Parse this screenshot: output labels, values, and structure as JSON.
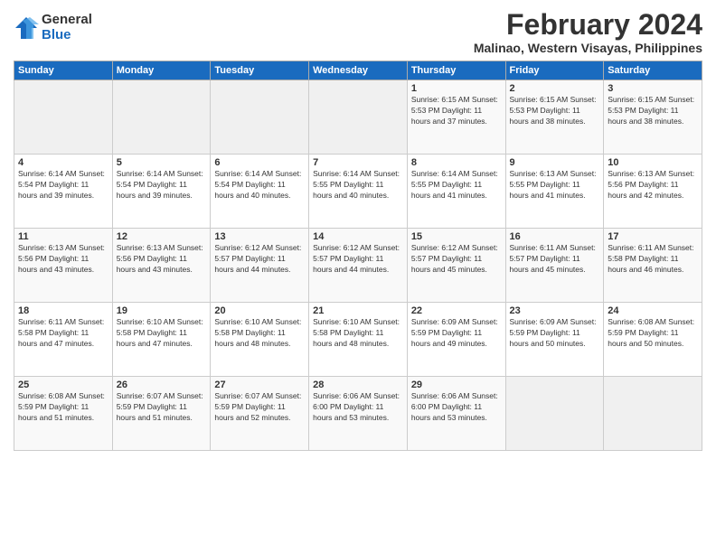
{
  "logo": {
    "general": "General",
    "blue": "Blue"
  },
  "title": "February 2024",
  "subtitle": "Malinao, Western Visayas, Philippines",
  "days_header": [
    "Sunday",
    "Monday",
    "Tuesday",
    "Wednesday",
    "Thursday",
    "Friday",
    "Saturday"
  ],
  "weeks": [
    [
      {
        "day": "",
        "content": ""
      },
      {
        "day": "",
        "content": ""
      },
      {
        "day": "",
        "content": ""
      },
      {
        "day": "",
        "content": ""
      },
      {
        "day": "1",
        "content": "Sunrise: 6:15 AM\nSunset: 5:53 PM\nDaylight: 11 hours\nand 37 minutes."
      },
      {
        "day": "2",
        "content": "Sunrise: 6:15 AM\nSunset: 5:53 PM\nDaylight: 11 hours\nand 38 minutes."
      },
      {
        "day": "3",
        "content": "Sunrise: 6:15 AM\nSunset: 5:53 PM\nDaylight: 11 hours\nand 38 minutes."
      }
    ],
    [
      {
        "day": "4",
        "content": "Sunrise: 6:14 AM\nSunset: 5:54 PM\nDaylight: 11 hours\nand 39 minutes."
      },
      {
        "day": "5",
        "content": "Sunrise: 6:14 AM\nSunset: 5:54 PM\nDaylight: 11 hours\nand 39 minutes."
      },
      {
        "day": "6",
        "content": "Sunrise: 6:14 AM\nSunset: 5:54 PM\nDaylight: 11 hours\nand 40 minutes."
      },
      {
        "day": "7",
        "content": "Sunrise: 6:14 AM\nSunset: 5:55 PM\nDaylight: 11 hours\nand 40 minutes."
      },
      {
        "day": "8",
        "content": "Sunrise: 6:14 AM\nSunset: 5:55 PM\nDaylight: 11 hours\nand 41 minutes."
      },
      {
        "day": "9",
        "content": "Sunrise: 6:13 AM\nSunset: 5:55 PM\nDaylight: 11 hours\nand 41 minutes."
      },
      {
        "day": "10",
        "content": "Sunrise: 6:13 AM\nSunset: 5:56 PM\nDaylight: 11 hours\nand 42 minutes."
      }
    ],
    [
      {
        "day": "11",
        "content": "Sunrise: 6:13 AM\nSunset: 5:56 PM\nDaylight: 11 hours\nand 43 minutes."
      },
      {
        "day": "12",
        "content": "Sunrise: 6:13 AM\nSunset: 5:56 PM\nDaylight: 11 hours\nand 43 minutes."
      },
      {
        "day": "13",
        "content": "Sunrise: 6:12 AM\nSunset: 5:57 PM\nDaylight: 11 hours\nand 44 minutes."
      },
      {
        "day": "14",
        "content": "Sunrise: 6:12 AM\nSunset: 5:57 PM\nDaylight: 11 hours\nand 44 minutes."
      },
      {
        "day": "15",
        "content": "Sunrise: 6:12 AM\nSunset: 5:57 PM\nDaylight: 11 hours\nand 45 minutes."
      },
      {
        "day": "16",
        "content": "Sunrise: 6:11 AM\nSunset: 5:57 PM\nDaylight: 11 hours\nand 45 minutes."
      },
      {
        "day": "17",
        "content": "Sunrise: 6:11 AM\nSunset: 5:58 PM\nDaylight: 11 hours\nand 46 minutes."
      }
    ],
    [
      {
        "day": "18",
        "content": "Sunrise: 6:11 AM\nSunset: 5:58 PM\nDaylight: 11 hours\nand 47 minutes."
      },
      {
        "day": "19",
        "content": "Sunrise: 6:10 AM\nSunset: 5:58 PM\nDaylight: 11 hours\nand 47 minutes."
      },
      {
        "day": "20",
        "content": "Sunrise: 6:10 AM\nSunset: 5:58 PM\nDaylight: 11 hours\nand 48 minutes."
      },
      {
        "day": "21",
        "content": "Sunrise: 6:10 AM\nSunset: 5:58 PM\nDaylight: 11 hours\nand 48 minutes."
      },
      {
        "day": "22",
        "content": "Sunrise: 6:09 AM\nSunset: 5:59 PM\nDaylight: 11 hours\nand 49 minutes."
      },
      {
        "day": "23",
        "content": "Sunrise: 6:09 AM\nSunset: 5:59 PM\nDaylight: 11 hours\nand 50 minutes."
      },
      {
        "day": "24",
        "content": "Sunrise: 6:08 AM\nSunset: 5:59 PM\nDaylight: 11 hours\nand 50 minutes."
      }
    ],
    [
      {
        "day": "25",
        "content": "Sunrise: 6:08 AM\nSunset: 5:59 PM\nDaylight: 11 hours\nand 51 minutes."
      },
      {
        "day": "26",
        "content": "Sunrise: 6:07 AM\nSunset: 5:59 PM\nDaylight: 11 hours\nand 51 minutes."
      },
      {
        "day": "27",
        "content": "Sunrise: 6:07 AM\nSunset: 5:59 PM\nDaylight: 11 hours\nand 52 minutes."
      },
      {
        "day": "28",
        "content": "Sunrise: 6:06 AM\nSunset: 6:00 PM\nDaylight: 11 hours\nand 53 minutes."
      },
      {
        "day": "29",
        "content": "Sunrise: 6:06 AM\nSunset: 6:00 PM\nDaylight: 11 hours\nand 53 minutes."
      },
      {
        "day": "",
        "content": ""
      },
      {
        "day": "",
        "content": ""
      }
    ]
  ]
}
